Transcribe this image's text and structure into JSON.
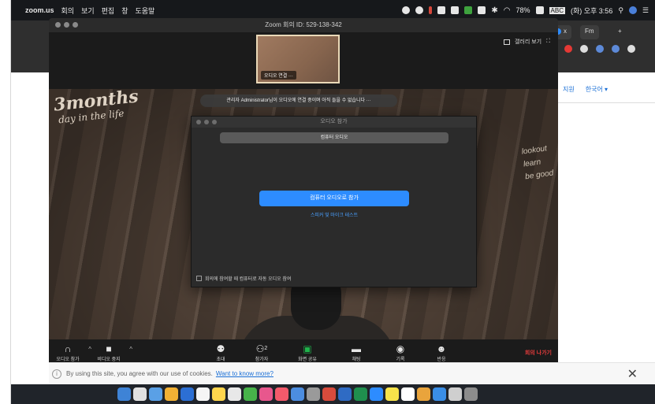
{
  "menubar": {
    "app": "zoom.us",
    "items": [
      "회의",
      "보기",
      "편집",
      "창",
      "도움말"
    ],
    "battery": "78%",
    "input_source": "ABC",
    "clock": "(화) 오후 3:56"
  },
  "browser": {
    "tab_label": "x",
    "tab2_label": "Fm",
    "nav_link": "지원",
    "language": "한국어 ▾"
  },
  "zoom": {
    "title": "Zoom 회의 ID: 529-138-342",
    "gallery_label": "갤러리 보기",
    "thumb_label": "오디오 연결 ···",
    "notice": "관리자 Administrator님이 오디오에 연결 중이며 아직 들을 수 없습니다 ···",
    "sign_main": "3months",
    "sign_sub": "day in the life",
    "neon_text": "lookout\nlearn\nbe good"
  },
  "dialog": {
    "title": "오디오 참가",
    "segment": "컴퓨터 오디오",
    "join_button": "컴퓨터 오디오로 참가",
    "test_link": "스피커 및 마이크 테스트",
    "auto_join": "회의에 참여할 때 컴퓨터로 자동 오디오 참여"
  },
  "toolbar": {
    "audio": "오디오 참가",
    "video": "비디오 중지",
    "invite": "초대",
    "participants": "참가자",
    "participants_count": "2",
    "share": "화면 공유",
    "chat": "채팅",
    "record": "기록",
    "reactions": "반응",
    "leave": "회의 나가기"
  },
  "cookie": {
    "text": "By using this site, you agree with our use of cookies.",
    "link": "Want to know more?",
    "close": "✕"
  },
  "colors": {
    "accent": "#2d8cff",
    "leave": "#e33b3b",
    "share": "#1fb34b"
  }
}
